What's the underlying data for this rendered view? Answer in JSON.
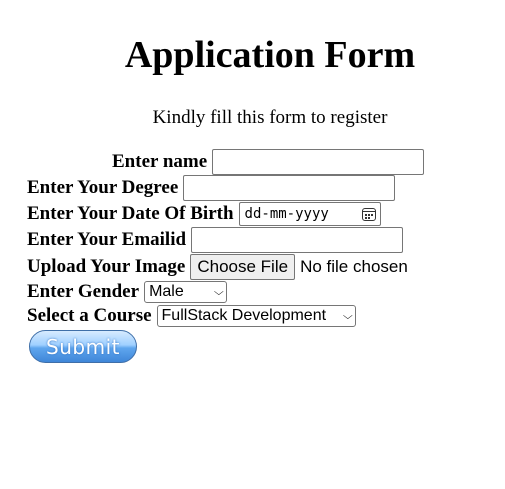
{
  "form": {
    "title": "Application Form",
    "subtitle": "Kindly fill this form to register",
    "name_label": "Enter name",
    "degree_label": "Enter Your Degree",
    "dob_label": "Enter Your Date Of Birth",
    "dob_placeholder": "dd-mm-yyyy",
    "email_label": "Enter Your Emailid",
    "image_label": "Upload Your Image",
    "file_button": "Choose File",
    "file_status": "No file chosen",
    "gender_label": "Enter Gender",
    "gender_value": "Male",
    "course_label": "Select a Course",
    "course_value": "FullStack Development",
    "submit_label": "Submit"
  }
}
